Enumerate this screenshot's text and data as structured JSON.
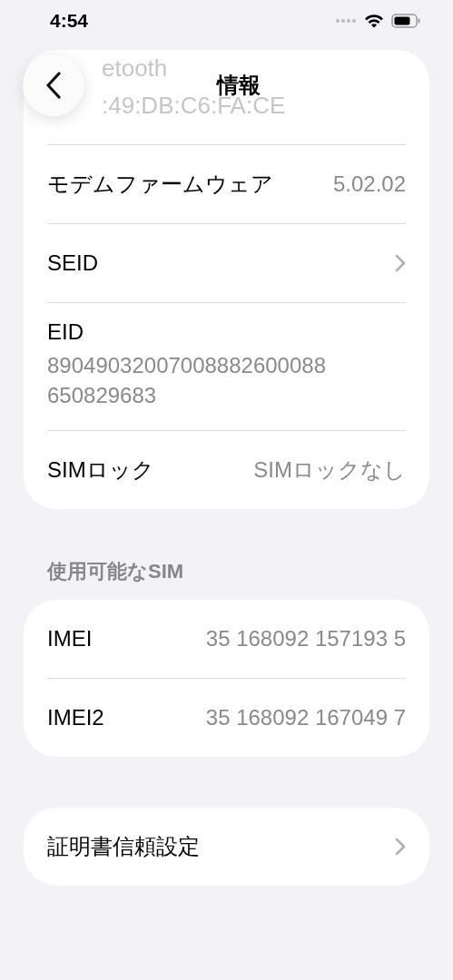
{
  "status_bar": {
    "time": "4:54"
  },
  "nav": {
    "title": "情報"
  },
  "groups": [
    {
      "rows": [
        {
          "kind": "partial",
          "lines": [
            "etooth",
            ":49:DB:C6:FA:CE"
          ]
        },
        {
          "kind": "value",
          "label": "モデムファームウェア",
          "value": "5.02.02"
        },
        {
          "kind": "link",
          "label": "SEID"
        },
        {
          "kind": "stacked",
          "label": "EID",
          "lines": [
            "89049032007008882600088",
            "650829683"
          ]
        },
        {
          "kind": "value",
          "label": "SIMロック",
          "value": "SIMロックなし"
        }
      ]
    },
    {
      "header": "使用可能なSIM",
      "rows": [
        {
          "kind": "value",
          "label": "IMEI",
          "value": "35 168092 157193 5"
        },
        {
          "kind": "value",
          "label": "IMEI2",
          "value": "35 168092 167049 7"
        }
      ]
    },
    {
      "rows": [
        {
          "kind": "link",
          "label": "証明書信頼設定"
        }
      ]
    }
  ]
}
